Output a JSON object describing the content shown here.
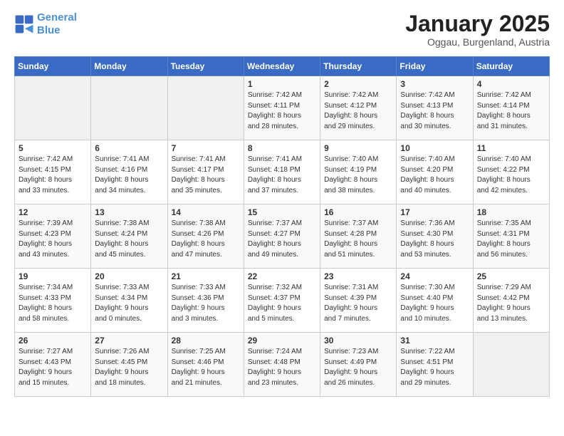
{
  "logo": {
    "line1": "General",
    "line2": "Blue"
  },
  "title": "January 2025",
  "subtitle": "Oggau, Burgenland, Austria",
  "weekdays": [
    "Sunday",
    "Monday",
    "Tuesday",
    "Wednesday",
    "Thursday",
    "Friday",
    "Saturday"
  ],
  "weeks": [
    [
      {
        "day": "",
        "text": ""
      },
      {
        "day": "",
        "text": ""
      },
      {
        "day": "",
        "text": ""
      },
      {
        "day": "1",
        "text": "Sunrise: 7:42 AM\nSunset: 4:11 PM\nDaylight: 8 hours\nand 28 minutes."
      },
      {
        "day": "2",
        "text": "Sunrise: 7:42 AM\nSunset: 4:12 PM\nDaylight: 8 hours\nand 29 minutes."
      },
      {
        "day": "3",
        "text": "Sunrise: 7:42 AM\nSunset: 4:13 PM\nDaylight: 8 hours\nand 30 minutes."
      },
      {
        "day": "4",
        "text": "Sunrise: 7:42 AM\nSunset: 4:14 PM\nDaylight: 8 hours\nand 31 minutes."
      }
    ],
    [
      {
        "day": "5",
        "text": "Sunrise: 7:42 AM\nSunset: 4:15 PM\nDaylight: 8 hours\nand 33 minutes."
      },
      {
        "day": "6",
        "text": "Sunrise: 7:41 AM\nSunset: 4:16 PM\nDaylight: 8 hours\nand 34 minutes."
      },
      {
        "day": "7",
        "text": "Sunrise: 7:41 AM\nSunset: 4:17 PM\nDaylight: 8 hours\nand 35 minutes."
      },
      {
        "day": "8",
        "text": "Sunrise: 7:41 AM\nSunset: 4:18 PM\nDaylight: 8 hours\nand 37 minutes."
      },
      {
        "day": "9",
        "text": "Sunrise: 7:40 AM\nSunset: 4:19 PM\nDaylight: 8 hours\nand 38 minutes."
      },
      {
        "day": "10",
        "text": "Sunrise: 7:40 AM\nSunset: 4:20 PM\nDaylight: 8 hours\nand 40 minutes."
      },
      {
        "day": "11",
        "text": "Sunrise: 7:40 AM\nSunset: 4:22 PM\nDaylight: 8 hours\nand 42 minutes."
      }
    ],
    [
      {
        "day": "12",
        "text": "Sunrise: 7:39 AM\nSunset: 4:23 PM\nDaylight: 8 hours\nand 43 minutes."
      },
      {
        "day": "13",
        "text": "Sunrise: 7:38 AM\nSunset: 4:24 PM\nDaylight: 8 hours\nand 45 minutes."
      },
      {
        "day": "14",
        "text": "Sunrise: 7:38 AM\nSunset: 4:26 PM\nDaylight: 8 hours\nand 47 minutes."
      },
      {
        "day": "15",
        "text": "Sunrise: 7:37 AM\nSunset: 4:27 PM\nDaylight: 8 hours\nand 49 minutes."
      },
      {
        "day": "16",
        "text": "Sunrise: 7:37 AM\nSunset: 4:28 PM\nDaylight: 8 hours\nand 51 minutes."
      },
      {
        "day": "17",
        "text": "Sunrise: 7:36 AM\nSunset: 4:30 PM\nDaylight: 8 hours\nand 53 minutes."
      },
      {
        "day": "18",
        "text": "Sunrise: 7:35 AM\nSunset: 4:31 PM\nDaylight: 8 hours\nand 56 minutes."
      }
    ],
    [
      {
        "day": "19",
        "text": "Sunrise: 7:34 AM\nSunset: 4:33 PM\nDaylight: 8 hours\nand 58 minutes."
      },
      {
        "day": "20",
        "text": "Sunrise: 7:33 AM\nSunset: 4:34 PM\nDaylight: 9 hours\nand 0 minutes."
      },
      {
        "day": "21",
        "text": "Sunrise: 7:33 AM\nSunset: 4:36 PM\nDaylight: 9 hours\nand 3 minutes."
      },
      {
        "day": "22",
        "text": "Sunrise: 7:32 AM\nSunset: 4:37 PM\nDaylight: 9 hours\nand 5 minutes."
      },
      {
        "day": "23",
        "text": "Sunrise: 7:31 AM\nSunset: 4:39 PM\nDaylight: 9 hours\nand 7 minutes."
      },
      {
        "day": "24",
        "text": "Sunrise: 7:30 AM\nSunset: 4:40 PM\nDaylight: 9 hours\nand 10 minutes."
      },
      {
        "day": "25",
        "text": "Sunrise: 7:29 AM\nSunset: 4:42 PM\nDaylight: 9 hours\nand 13 minutes."
      }
    ],
    [
      {
        "day": "26",
        "text": "Sunrise: 7:27 AM\nSunset: 4:43 PM\nDaylight: 9 hours\nand 15 minutes."
      },
      {
        "day": "27",
        "text": "Sunrise: 7:26 AM\nSunset: 4:45 PM\nDaylight: 9 hours\nand 18 minutes."
      },
      {
        "day": "28",
        "text": "Sunrise: 7:25 AM\nSunset: 4:46 PM\nDaylight: 9 hours\nand 21 minutes."
      },
      {
        "day": "29",
        "text": "Sunrise: 7:24 AM\nSunset: 4:48 PM\nDaylight: 9 hours\nand 23 minutes."
      },
      {
        "day": "30",
        "text": "Sunrise: 7:23 AM\nSunset: 4:49 PM\nDaylight: 9 hours\nand 26 minutes."
      },
      {
        "day": "31",
        "text": "Sunrise: 7:22 AM\nSunset: 4:51 PM\nDaylight: 9 hours\nand 29 minutes."
      },
      {
        "day": "",
        "text": ""
      }
    ]
  ]
}
